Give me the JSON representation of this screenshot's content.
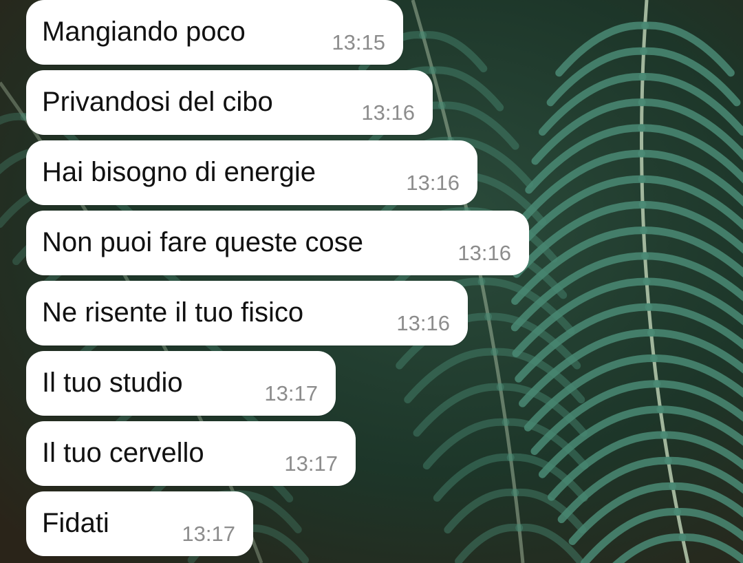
{
  "chat": {
    "messages": [
      {
        "text": "Mangiando poco",
        "time": "13:15"
      },
      {
        "text": "Privandosi del cibo",
        "time": "13:16"
      },
      {
        "text": "Hai bisogno di energie",
        "time": "13:16"
      },
      {
        "text": "Non puoi fare queste cose",
        "time": "13:16"
      },
      {
        "text": "Ne risente il tuo fisico",
        "time": "13:16"
      },
      {
        "text": "Il tuo studio",
        "time": "13:17"
      },
      {
        "text": "Il tuo cervello",
        "time": "13:17"
      },
      {
        "text": "Fidati",
        "time": "13:17"
      }
    ]
  },
  "theme": {
    "bubble_color": "#ffffff",
    "text_color": "#111111",
    "time_color": "#8c8c8c",
    "wallpaper": "palm-leaves-wallpaper",
    "wallpaper_base": "#1f3a2e",
    "leaf_color": "#4a8a74"
  }
}
